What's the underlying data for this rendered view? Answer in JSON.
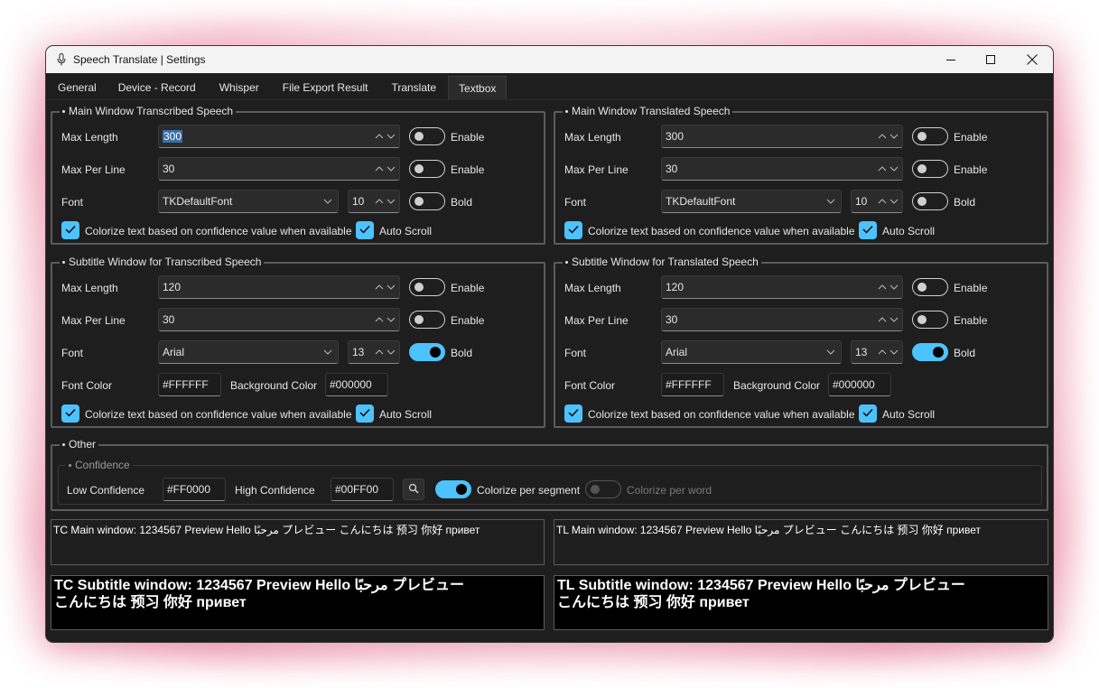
{
  "window": {
    "title": "Speech Translate | Settings"
  },
  "tabs": [
    {
      "label": "General"
    },
    {
      "label": "Device - Record"
    },
    {
      "label": "Whisper"
    },
    {
      "label": "File Export Result"
    },
    {
      "label": "Translate"
    },
    {
      "label": "Textbox",
      "active": true
    }
  ],
  "labels": {
    "max_length": "Max Length",
    "max_per_line": "Max Per Line",
    "font": "Font",
    "enable": "Enable",
    "bold": "Bold",
    "colorize": "Colorize text based on confidence value when available",
    "auto_scroll": "Auto Scroll",
    "font_color": "Font Color",
    "background_color": "Background Color"
  },
  "mw_tc": {
    "legend": "Main Window Transcribed Speech",
    "max_length": "300",
    "max_per_line": "30",
    "font": "TKDefaultFont",
    "font_size": "10",
    "max_length_enabled": false,
    "max_per_line_enabled": false,
    "bold": false,
    "colorize": true,
    "auto_scroll": true
  },
  "mw_tl": {
    "legend": "Main Window Translated Speech",
    "max_length": "300",
    "max_per_line": "30",
    "font": "TKDefaultFont",
    "font_size": "10",
    "max_length_enabled": false,
    "max_per_line_enabled": false,
    "bold": false,
    "colorize": true,
    "auto_scroll": true
  },
  "sw_tc": {
    "legend": "Subtitle Window for Transcribed Speech",
    "max_length": "120",
    "max_per_line": "30",
    "font": "Arial",
    "font_size": "13",
    "max_length_enabled": false,
    "max_per_line_enabled": false,
    "bold": true,
    "font_color": "#FFFFFF",
    "background_color": "#000000",
    "colorize": true,
    "auto_scroll": true
  },
  "sw_tl": {
    "legend": "Subtitle Window for Translated Speech",
    "max_length": "120",
    "max_per_line": "30",
    "font": "Arial",
    "font_size": "13",
    "max_length_enabled": false,
    "max_per_line_enabled": false,
    "bold": true,
    "font_color": "#FFFFFF",
    "background_color": "#000000",
    "colorize": true,
    "auto_scroll": true
  },
  "other": {
    "legend": "Other",
    "confidence": {
      "legend": "Confidence",
      "low_label": "Low Confidence",
      "low_value": "#FF0000",
      "high_label": "High Confidence",
      "high_value": "#00FF00",
      "per_segment_label": "Colorize per segment",
      "per_segment": true,
      "per_word_label": "Colorize per word",
      "per_word": false
    }
  },
  "previews": {
    "tc_main": "TC Main window: 1234567 Preview Hello مرحبًا プレビュー こんにちは 预习 你好 привет",
    "tl_main": "TL Main window: 1234567 Preview Hello مرحبًا プレビュー こんにちは 预习 你好 привет",
    "tc_sub_line1": "TC Subtitle window: 1234567 Preview Hello مرحبًا プレビュー",
    "tc_sub_line2": "こんにちは 预习 你好 привет",
    "tl_sub_line1": "TL Subtitle window: 1234567 Preview Hello مرحبًا プレビュー",
    "tl_sub_line2": "こんにちは 预习 你好 привет"
  },
  "colors": {
    "accent": "#4cc2ff",
    "background": "#1e1e1e"
  },
  "icons": {
    "app": "microphone-icon",
    "minimize": "minimize-icon",
    "maximize": "maximize-icon",
    "close": "close-icon",
    "search": "search-icon"
  }
}
